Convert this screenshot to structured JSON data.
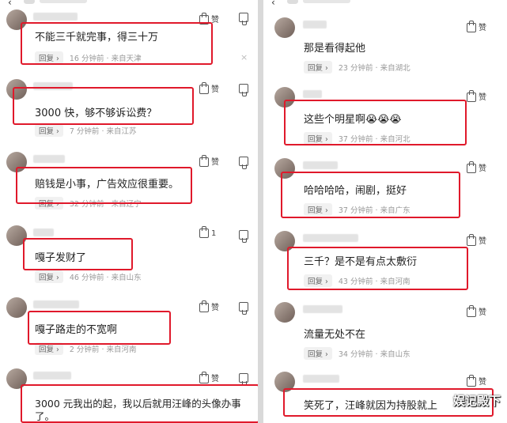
{
  "ui": {
    "like_label": "赞",
    "reply_label": "回复",
    "reply_arrow": "›",
    "dot": "·",
    "close_glyph": "×"
  },
  "left_comments": [
    {
      "text": "不能三千就完事，得三十万",
      "time": "16 分钟前",
      "location": "来自天津",
      "likes": ""
    },
    {
      "text": "3000 快，够不够诉讼费？",
      "time": "7 分钟前",
      "location": "来自江苏",
      "likes": ""
    },
    {
      "text": "赔钱是小事，广告效应很重要。",
      "time": "32 分钟前",
      "location": "来自辽宁",
      "likes": ""
    },
    {
      "text": "嘎子发财了",
      "time": "46 分钟前",
      "location": "来自山东",
      "likes": "1"
    },
    {
      "text": "嘎子路走的不宽啊",
      "time": "2 分钟前",
      "location": "来自河南",
      "likes": ""
    },
    {
      "text": "3000 元我出的起，我以后就用汪峰的头像办事",
      "text2": "了。",
      "time": "",
      "location": "",
      "likes": ""
    }
  ],
  "right_comments": [
    {
      "text": "那是看得起他",
      "time": "23 分钟前",
      "location": "来自湖北",
      "likes": ""
    },
    {
      "text": "这些个明星啊😭😭😭",
      "time": "37 分钟前",
      "location": "来自河北",
      "likes": ""
    },
    {
      "text": "哈哈哈哈，闹剧，挺好",
      "time": "37 分钟前",
      "location": "来自广东",
      "likes": ""
    },
    {
      "text": "三千？是不是有点太敷衍",
      "time": "43 分钟前",
      "location": "来自河南",
      "likes": ""
    },
    {
      "text": "流量无处不在",
      "time": "34 分钟前",
      "location": "来自山东",
      "likes": ""
    },
    {
      "text": "笑死了，汪峰就因为持股就上",
      "time": "",
      "location": "",
      "likes": ""
    }
  ],
  "watermark": "娱记殿下"
}
